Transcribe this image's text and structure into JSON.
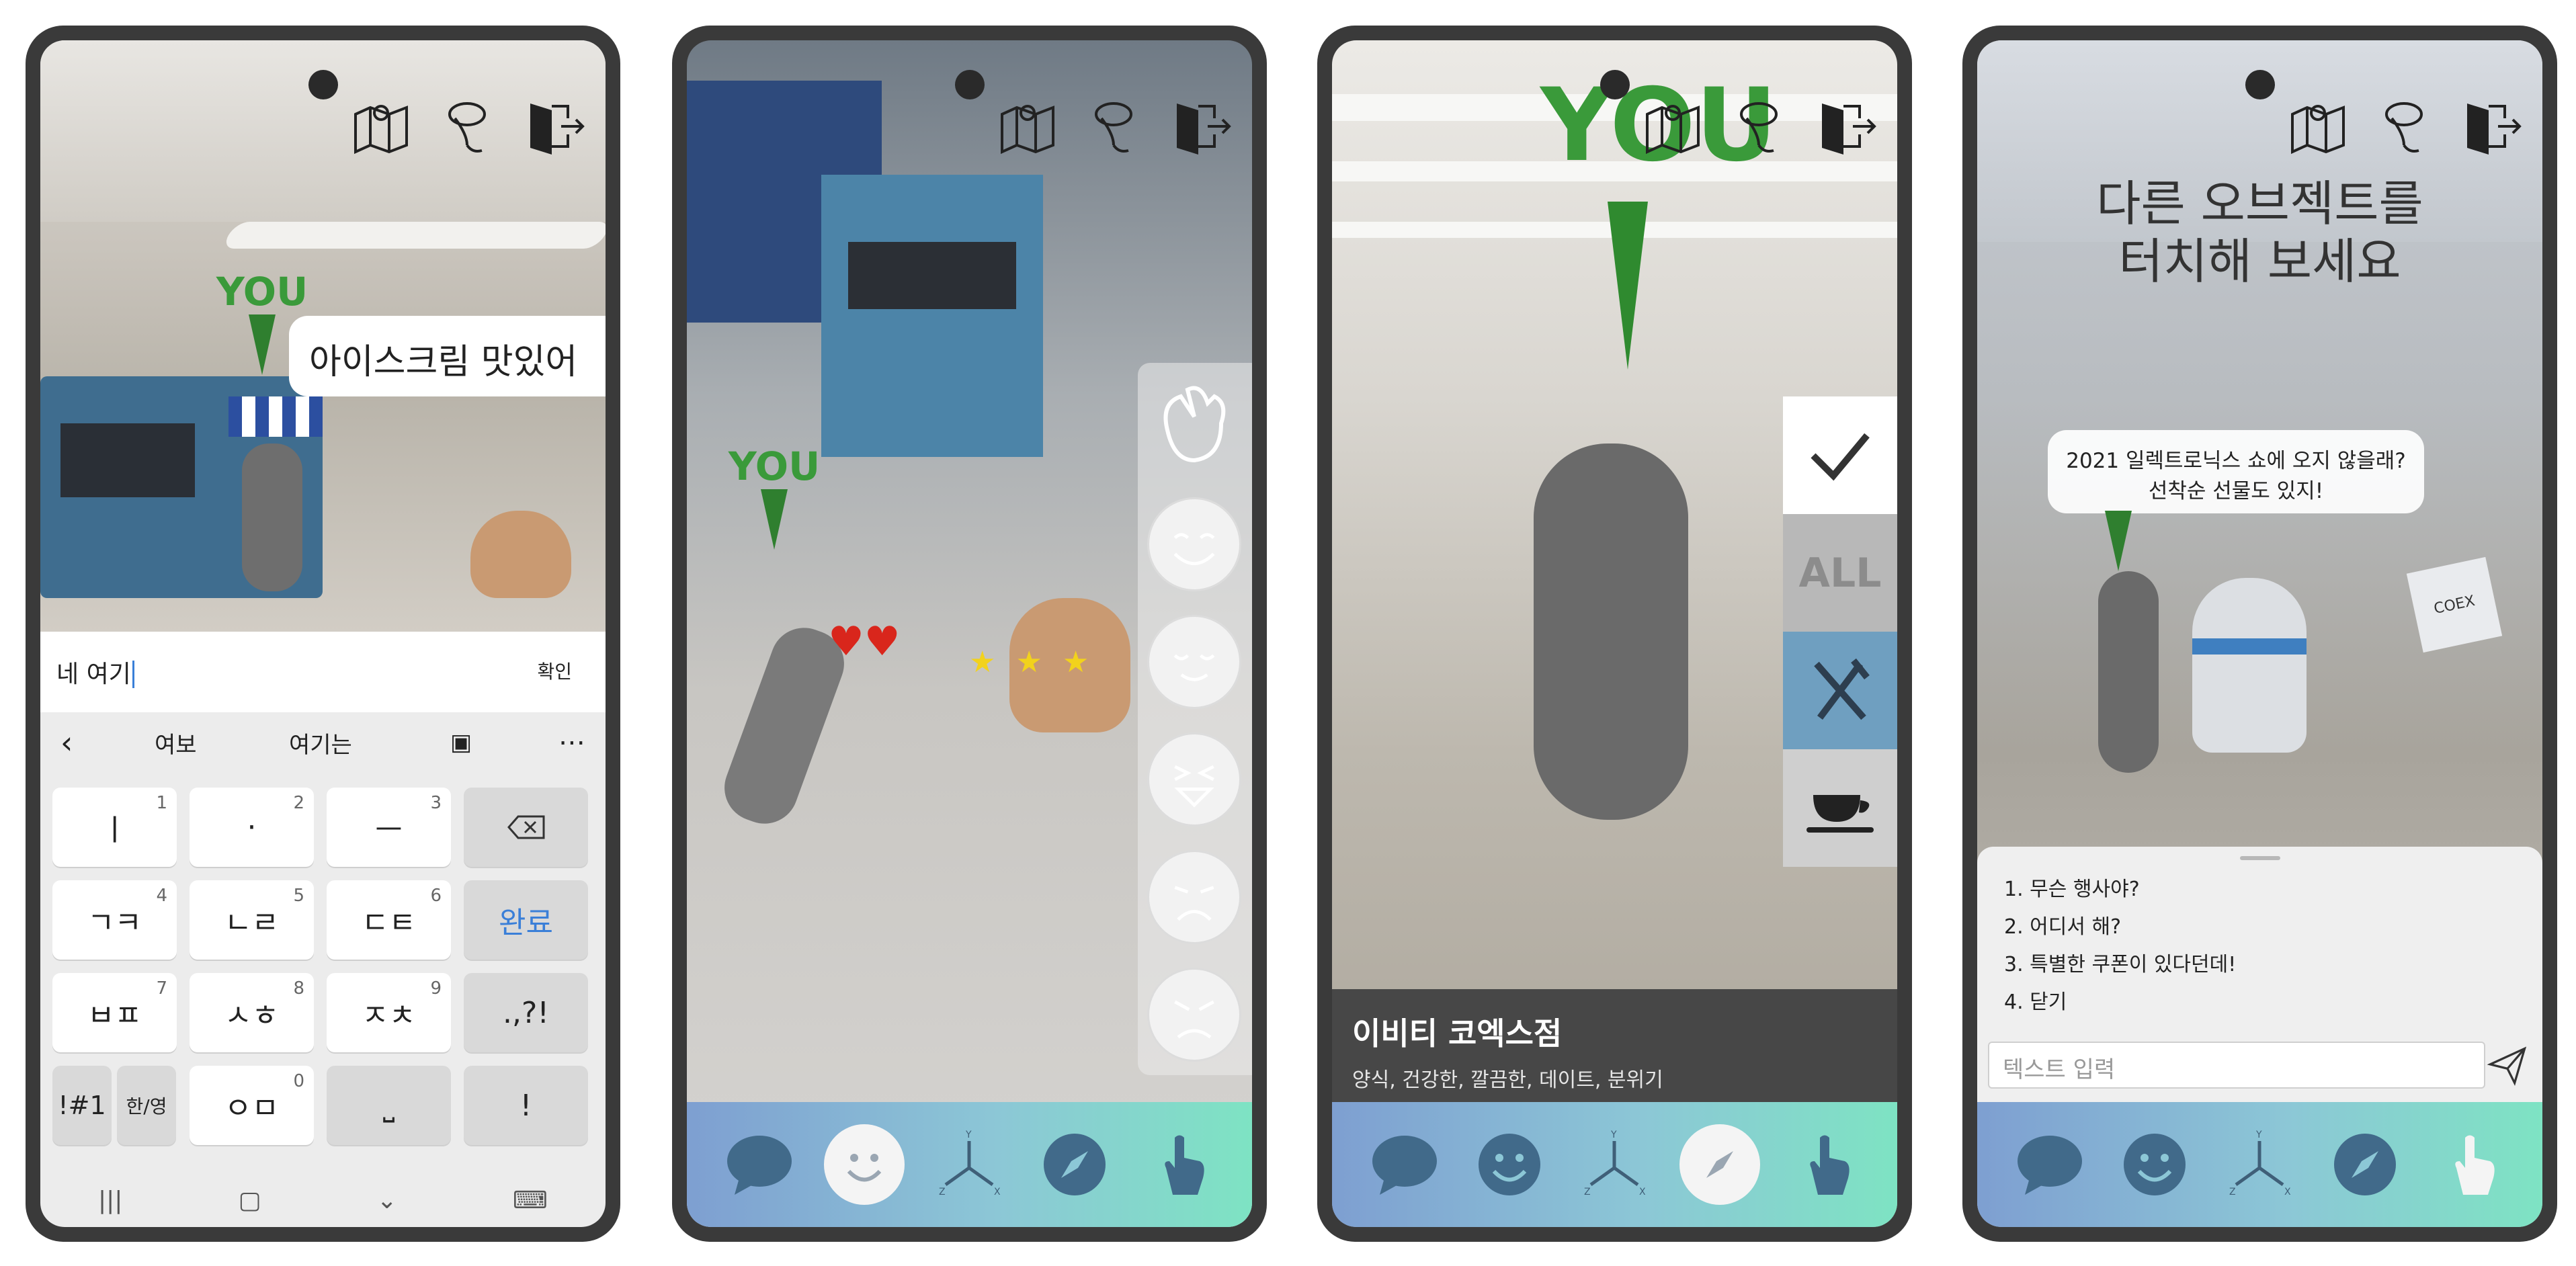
{
  "screen1": {
    "you_label": "YOU",
    "bubble_text": "아이스크림 맛있어",
    "input_value": "네 여기",
    "confirm_label": "확인",
    "suggestions": [
      "여보",
      "여기는"
    ],
    "keys": {
      "r1": [
        {
          "t": "ㅣ",
          "n": "1"
        },
        {
          "t": "·",
          "n": "2"
        },
        {
          "t": "ㅡ",
          "n": "3"
        }
      ],
      "r2": [
        {
          "t": "ㄱㅋ",
          "n": "4"
        },
        {
          "t": "ㄴㄹ",
          "n": "5"
        },
        {
          "t": "ㄷㅌ",
          "n": "6"
        }
      ],
      "r3": [
        {
          "t": "ㅂㅍ",
          "n": "7"
        },
        {
          "t": "ㅅㅎ",
          "n": "8"
        },
        {
          "t": "ㅈㅊ",
          "n": "9"
        }
      ],
      "r4": [
        {
          "t": "ㅇㅁ",
          "n": "0"
        }
      ],
      "done": "완료",
      "punct": ".,?!",
      "sym": "!#1",
      "lang": "한/영",
      "excl": "!"
    }
  },
  "screen2": {
    "you_label": "YOU"
  },
  "screen3": {
    "you_label": "YOU",
    "all_label": "ALL",
    "store_name": "이비티 코엑스점",
    "store_tags": "양식, 건강한, 깔끔한, 데이트, 분위기"
  },
  "screen4": {
    "title_line1": "다른 오브젝트를",
    "title_line2": "터치해 보세요",
    "bubble_line1": "2021 일렉트로닉스 쇼에 오지 않을래?",
    "bubble_line2": "선착순 선물도 있지!",
    "choices": [
      "1. 무슨 행사야?",
      "2. 어디서 해?",
      "3. 특별한 쿠폰이 있다던데!",
      "4. 닫기"
    ],
    "text_placeholder": "텍스트 입력",
    "cube_label": "COEX"
  },
  "colors": {
    "nav_gradient_start": "#7e9fd1",
    "nav_gradient_end": "#7ee3c3",
    "you_green": "#3a9a3a",
    "done_blue": "#3a7fd8"
  },
  "icons": [
    "map-icon",
    "location-pin-icon",
    "exit-icon",
    "chat-icon",
    "smile-icon",
    "axis-icon",
    "compass-icon",
    "hand-pointer-icon",
    "wave-hand-icon",
    "check-icon",
    "fork-knife-icon",
    "coffee-cup-icon",
    "send-icon",
    "backspace-icon"
  ]
}
